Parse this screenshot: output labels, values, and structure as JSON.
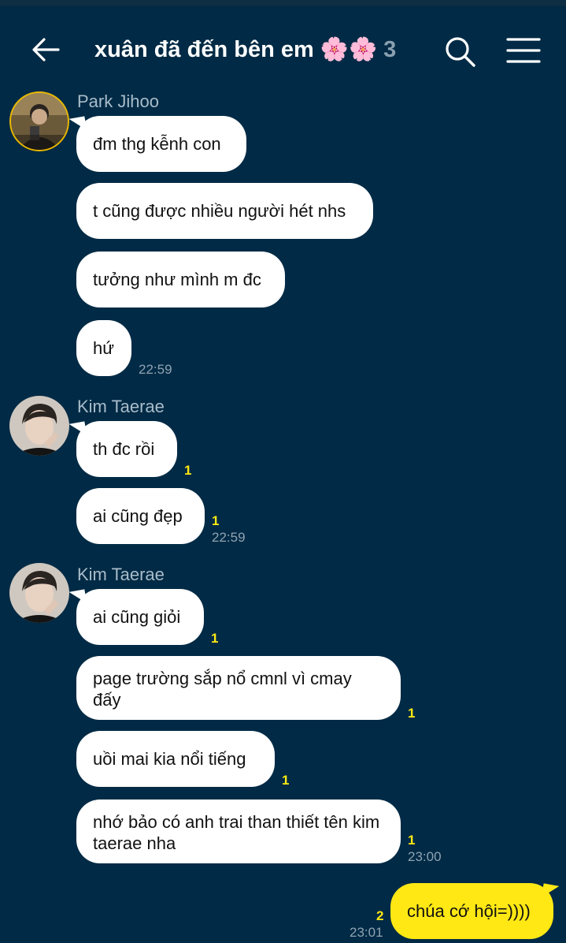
{
  "header": {
    "title": "xuân đã đến bên em 🌸🌸",
    "member_count": "3",
    "icons": {
      "back": "arrow-left-icon",
      "search": "search-icon",
      "menu": "hamburger-menu-icon"
    }
  },
  "colors": {
    "background": "#002a45",
    "bubble_other": "#ffffff",
    "bubble_mine": "#ffe814",
    "unread": "#ffe814",
    "meta": "#8fa3b3"
  },
  "groups": [
    {
      "sender": "Park Jihoo",
      "messages": [
        {
          "text": "đm thg kễnh con",
          "unread": "",
          "time": ""
        },
        {
          "text": "t cũng được nhiều người hét nhs",
          "unread": "",
          "time": ""
        },
        {
          "text": "tưởng như mình m đc",
          "unread": "",
          "time": ""
        },
        {
          "text": "hứ",
          "unread": "",
          "time": "22:59"
        }
      ]
    },
    {
      "sender": "Kim Taerae",
      "messages": [
        {
          "text": "th đc rồi",
          "unread": "1",
          "time": ""
        },
        {
          "text": "ai cũng đẹp",
          "unread": "1",
          "time": "22:59"
        }
      ]
    },
    {
      "sender": "Kim Taerae",
      "messages": [
        {
          "text": "ai cũng giỏi",
          "unread": "1",
          "time": ""
        },
        {
          "text": "page trường sắp nổ cmnl vì cmay đấy",
          "unread": "1",
          "time": ""
        },
        {
          "text": "uồi mai kia nổi tiếng",
          "unread": "1",
          "time": ""
        },
        {
          "text": "nhớ bảo có anh trai than thiết tên kim taerae nha",
          "unread": "1",
          "time": "23:00"
        }
      ]
    }
  ],
  "my_messages": [
    {
      "text": "chúa cớ hội=))))",
      "unread": "2",
      "time": "23:01"
    }
  ]
}
